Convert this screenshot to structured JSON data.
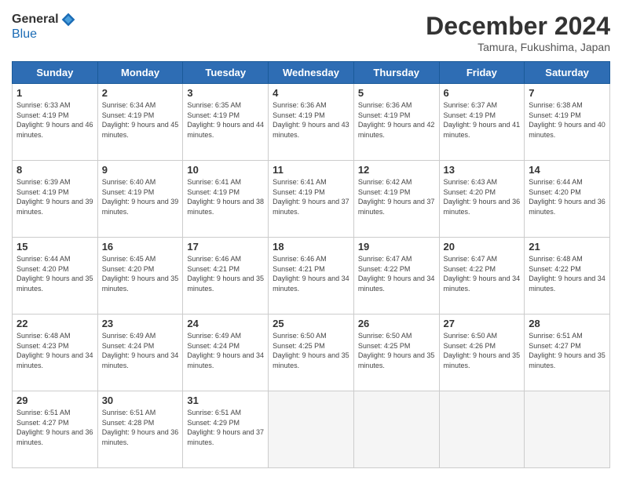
{
  "logo": {
    "general": "General",
    "blue": "Blue"
  },
  "title": "December 2024",
  "location": "Tamura, Fukushima, Japan",
  "days_of_week": [
    "Sunday",
    "Monday",
    "Tuesday",
    "Wednesday",
    "Thursday",
    "Friday",
    "Saturday"
  ],
  "weeks": [
    [
      {
        "day": "1",
        "sunrise": "6:33 AM",
        "sunset": "4:19 PM",
        "daylight": "9 hours and 46 minutes."
      },
      {
        "day": "2",
        "sunrise": "6:34 AM",
        "sunset": "4:19 PM",
        "daylight": "9 hours and 45 minutes."
      },
      {
        "day": "3",
        "sunrise": "6:35 AM",
        "sunset": "4:19 PM",
        "daylight": "9 hours and 44 minutes."
      },
      {
        "day": "4",
        "sunrise": "6:36 AM",
        "sunset": "4:19 PM",
        "daylight": "9 hours and 43 minutes."
      },
      {
        "day": "5",
        "sunrise": "6:36 AM",
        "sunset": "4:19 PM",
        "daylight": "9 hours and 42 minutes."
      },
      {
        "day": "6",
        "sunrise": "6:37 AM",
        "sunset": "4:19 PM",
        "daylight": "9 hours and 41 minutes."
      },
      {
        "day": "7",
        "sunrise": "6:38 AM",
        "sunset": "4:19 PM",
        "daylight": "9 hours and 40 minutes."
      }
    ],
    [
      {
        "day": "8",
        "sunrise": "6:39 AM",
        "sunset": "4:19 PM",
        "daylight": "9 hours and 39 minutes."
      },
      {
        "day": "9",
        "sunrise": "6:40 AM",
        "sunset": "4:19 PM",
        "daylight": "9 hours and 39 minutes."
      },
      {
        "day": "10",
        "sunrise": "6:41 AM",
        "sunset": "4:19 PM",
        "daylight": "9 hours and 38 minutes."
      },
      {
        "day": "11",
        "sunrise": "6:41 AM",
        "sunset": "4:19 PM",
        "daylight": "9 hours and 37 minutes."
      },
      {
        "day": "12",
        "sunrise": "6:42 AM",
        "sunset": "4:19 PM",
        "daylight": "9 hours and 37 minutes."
      },
      {
        "day": "13",
        "sunrise": "6:43 AM",
        "sunset": "4:20 PM",
        "daylight": "9 hours and 36 minutes."
      },
      {
        "day": "14",
        "sunrise": "6:44 AM",
        "sunset": "4:20 PM",
        "daylight": "9 hours and 36 minutes."
      }
    ],
    [
      {
        "day": "15",
        "sunrise": "6:44 AM",
        "sunset": "4:20 PM",
        "daylight": "9 hours and 35 minutes."
      },
      {
        "day": "16",
        "sunrise": "6:45 AM",
        "sunset": "4:20 PM",
        "daylight": "9 hours and 35 minutes."
      },
      {
        "day": "17",
        "sunrise": "6:46 AM",
        "sunset": "4:21 PM",
        "daylight": "9 hours and 35 minutes."
      },
      {
        "day": "18",
        "sunrise": "6:46 AM",
        "sunset": "4:21 PM",
        "daylight": "9 hours and 34 minutes."
      },
      {
        "day": "19",
        "sunrise": "6:47 AM",
        "sunset": "4:22 PM",
        "daylight": "9 hours and 34 minutes."
      },
      {
        "day": "20",
        "sunrise": "6:47 AM",
        "sunset": "4:22 PM",
        "daylight": "9 hours and 34 minutes."
      },
      {
        "day": "21",
        "sunrise": "6:48 AM",
        "sunset": "4:22 PM",
        "daylight": "9 hours and 34 minutes."
      }
    ],
    [
      {
        "day": "22",
        "sunrise": "6:48 AM",
        "sunset": "4:23 PM",
        "daylight": "9 hours and 34 minutes."
      },
      {
        "day": "23",
        "sunrise": "6:49 AM",
        "sunset": "4:24 PM",
        "daylight": "9 hours and 34 minutes."
      },
      {
        "day": "24",
        "sunrise": "6:49 AM",
        "sunset": "4:24 PM",
        "daylight": "9 hours and 34 minutes."
      },
      {
        "day": "25",
        "sunrise": "6:50 AM",
        "sunset": "4:25 PM",
        "daylight": "9 hours and 35 minutes."
      },
      {
        "day": "26",
        "sunrise": "6:50 AM",
        "sunset": "4:25 PM",
        "daylight": "9 hours and 35 minutes."
      },
      {
        "day": "27",
        "sunrise": "6:50 AM",
        "sunset": "4:26 PM",
        "daylight": "9 hours and 35 minutes."
      },
      {
        "day": "28",
        "sunrise": "6:51 AM",
        "sunset": "4:27 PM",
        "daylight": "9 hours and 35 minutes."
      }
    ],
    [
      {
        "day": "29",
        "sunrise": "6:51 AM",
        "sunset": "4:27 PM",
        "daylight": "9 hours and 36 minutes."
      },
      {
        "day": "30",
        "sunrise": "6:51 AM",
        "sunset": "4:28 PM",
        "daylight": "9 hours and 36 minutes."
      },
      {
        "day": "31",
        "sunrise": "6:51 AM",
        "sunset": "4:29 PM",
        "daylight": "9 hours and 37 minutes."
      },
      null,
      null,
      null,
      null
    ]
  ],
  "labels": {
    "sunrise": "Sunrise:",
    "sunset": "Sunset:",
    "daylight": "Daylight:"
  }
}
